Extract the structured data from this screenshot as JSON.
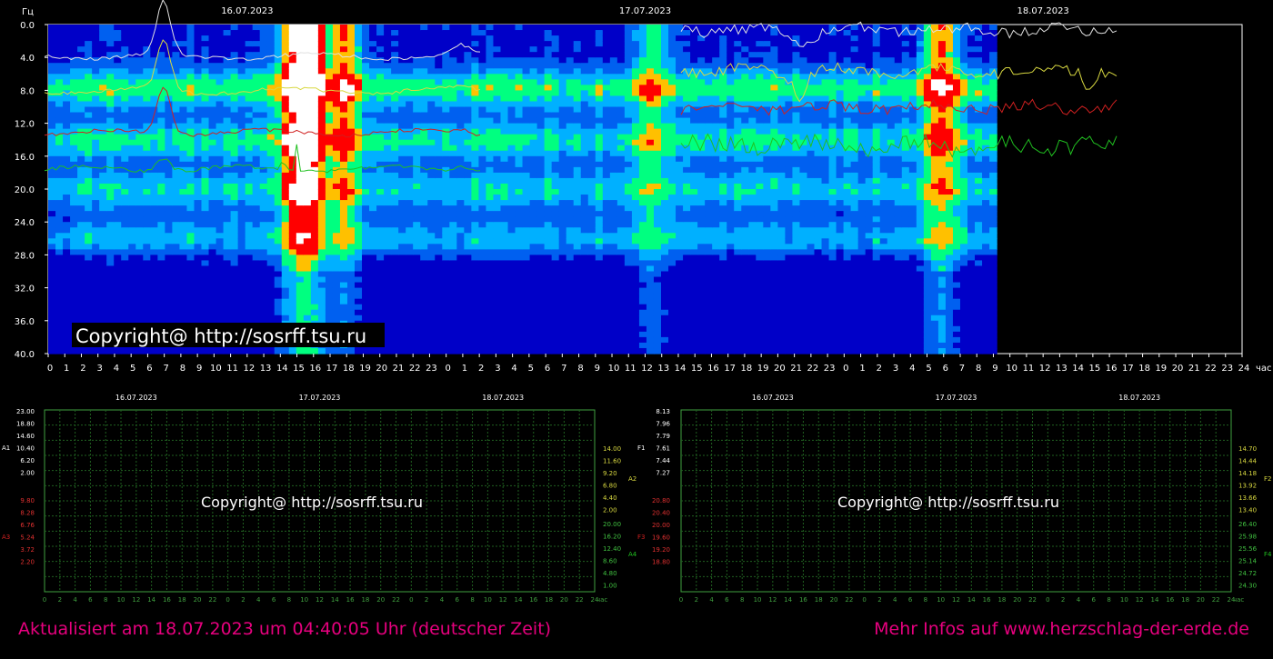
{
  "footer": {
    "updated": "Aktualisiert am 18.07.2023 um 04:40:05 Uhr (deutscher Zeit)",
    "more_info": "Mehr Infos auf www.herzschlag-der-erde.de"
  },
  "chart_data": [
    {
      "type": "heatmap",
      "title": "",
      "dates": [
        "16.07.2023",
        "17.07.2023",
        "18.07.2023"
      ],
      "ylabel": "Гц",
      "xlabel": "час",
      "y_ticks": [
        "0.0",
        "4.0",
        "8.0",
        "12.0",
        "16.0",
        "20.0",
        "24.0",
        "28.0",
        "32.0",
        "36.0",
        "40.0"
      ],
      "ylim": [
        0,
        40
      ],
      "x_ticks": [
        "0",
        "1",
        "2",
        "3",
        "4",
        "5",
        "6",
        "7",
        "8",
        "9",
        "10",
        "11",
        "12",
        "13",
        "14",
        "15",
        "16",
        "17",
        "18",
        "19",
        "20",
        "21",
        "22",
        "23",
        "0",
        "1",
        "2",
        "3",
        "4",
        "5",
        "6",
        "7",
        "8",
        "9",
        "10",
        "11",
        "12",
        "13",
        "14",
        "15",
        "16",
        "17",
        "18",
        "19",
        "20",
        "21",
        "22",
        "23",
        "0",
        "1",
        "2",
        "3",
        "4",
        "5",
        "6",
        "7",
        "8",
        "9",
        "10",
        "11",
        "12",
        "13",
        "14",
        "15",
        "16",
        "17",
        "18",
        "19",
        "20",
        "21",
        "22",
        "23",
        "24"
      ],
      "xlim_hours": [
        0,
        72
      ],
      "data_end_hour": 57.2,
      "resonance_bands_hz": [
        7.8,
        14.1,
        20.0,
        26.0
      ],
      "bursts": [
        {
          "center_hour": 15.5,
          "intensity": "very high"
        },
        {
          "center_hour": 17.8,
          "intensity": "high"
        },
        {
          "center_hour": 36.5,
          "intensity": "medium"
        },
        {
          "center_hour": 53.8,
          "intensity": "high"
        }
      ],
      "watermark": "Copyright@ http://sosrff.tsu.ru",
      "colors": {
        "background": "#000000",
        "low": "#0000c8",
        "mid": "#00ff80",
        "high": "#ff0000",
        "max": "#ffffff"
      }
    },
    {
      "type": "line",
      "title": "",
      "dates": [
        "16.07.2023",
        "17.07.2023",
        "18.07.2023"
      ],
      "xlabel": "час",
      "x_ticks": [
        "0",
        "2",
        "4",
        "6",
        "8",
        "10",
        "12",
        "14",
        "16",
        "18",
        "20",
        "22",
        "0",
        "2",
        "4",
        "6",
        "8",
        "10",
        "12",
        "14",
        "16",
        "18",
        "20",
        "22",
        "0",
        "2",
        "4",
        "6",
        "8",
        "10",
        "12",
        "14",
        "16",
        "18",
        "20",
        "22",
        "24"
      ],
      "left_axis": {
        "A1": [
          "23.00",
          "18.80",
          "14.60",
          "10.40",
          "6.20",
          "2.00"
        ],
        "A3": [
          "9.80",
          "8.28",
          "6.76",
          "5.24",
          "3.72",
          "2.20"
        ]
      },
      "right_axis": {
        "A2": [
          "14.00",
          "11.60",
          "9.20",
          "6.80",
          "4.40",
          "2.00"
        ],
        "A4": [
          "20.00",
          "16.20",
          "12.40",
          "8.60",
          "4.80",
          "1.00"
        ]
      },
      "series": [
        {
          "name": "A1",
          "color": "#e0e0e0",
          "base": 4.2
        },
        {
          "name": "A2",
          "color": "#d8d840",
          "base": 4.6
        },
        {
          "name": "A3",
          "color": "#d02020",
          "base": 3.4
        },
        {
          "name": "A4",
          "color": "#20c020",
          "base": 1.8
        }
      ],
      "watermark": "Copyright@ http://sosrff.tsu.ru"
    },
    {
      "type": "line",
      "title": "",
      "dates": [
        "16.07.2023",
        "17.07.2023",
        "18.07.2023"
      ],
      "xlabel": "час",
      "x_ticks": [
        "0",
        "2",
        "4",
        "6",
        "8",
        "10",
        "12",
        "14",
        "16",
        "18",
        "20",
        "22",
        "0",
        "2",
        "4",
        "6",
        "8",
        "10",
        "12",
        "14",
        "16",
        "18",
        "20",
        "22",
        "0",
        "2",
        "4",
        "6",
        "8",
        "10",
        "12",
        "14",
        "16",
        "18",
        "20",
        "22",
        "24"
      ],
      "left_axis": {
        "F1": [
          "8.13",
          "7.96",
          "7.79",
          "7.61",
          "7.44",
          "7.27"
        ],
        "F3": [
          "20.80",
          "20.40",
          "20.00",
          "19.60",
          "19.20",
          "18.80"
        ]
      },
      "right_axis": {
        "F2": [
          "14.70",
          "14.44",
          "14.18",
          "13.92",
          "13.66",
          "13.40"
        ],
        "F4": [
          "26.40",
          "25.98",
          "25.56",
          "25.14",
          "24.72",
          "24.30"
        ]
      },
      "series": [
        {
          "name": "F1",
          "color": "#e0e0e0",
          "base": 7.85
        },
        {
          "name": "F2",
          "color": "#d8d840",
          "base": 14.3
        },
        {
          "name": "F3",
          "color": "#d02020",
          "base": 20.1
        },
        {
          "name": "F4",
          "color": "#20c020",
          "base": 25.4
        }
      ],
      "watermark": "Copyright@ http://sosrff.tsu.ru"
    }
  ]
}
